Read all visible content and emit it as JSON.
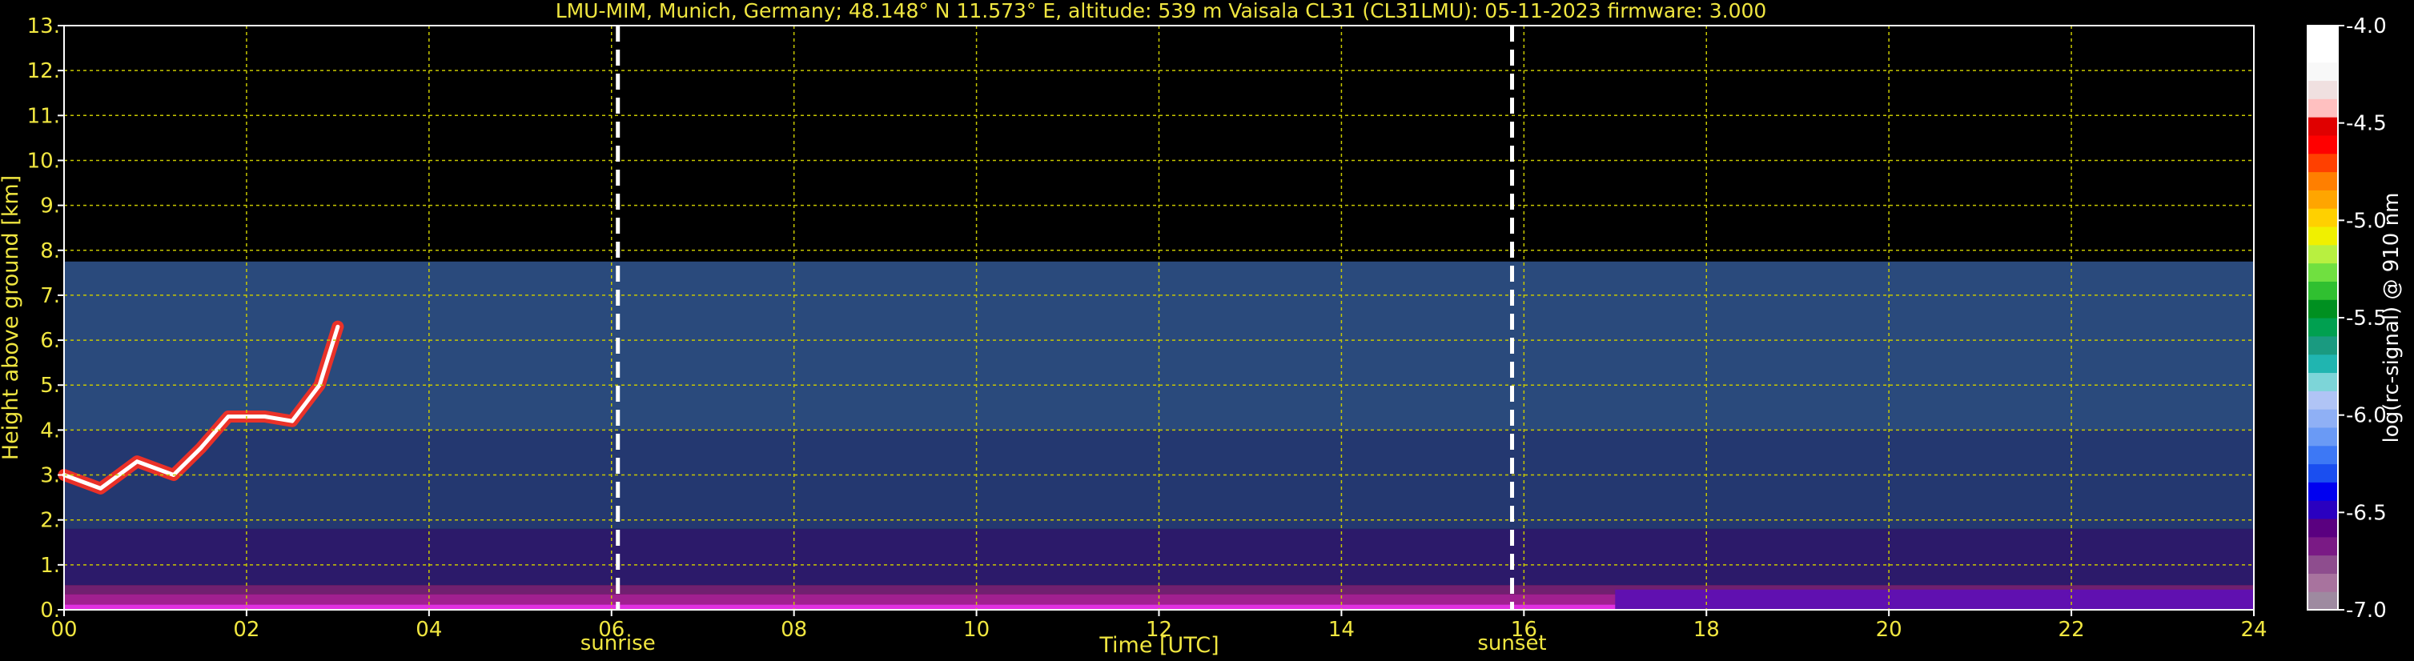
{
  "chart_data": {
    "type": "heatmap",
    "title": "LMU-MIM, Munich, Germany; 48.148° N 11.573° E, altitude: 539 m    Vaisala CL31 (CL31LMU): 05-11-2023    firmware: 3.000",
    "xlabel": "Time [UTC]",
    "ylabel": "Height above ground [km]",
    "xlim": [
      0,
      24
    ],
    "ylim": [
      0,
      13
    ],
    "x_ticks": [
      0,
      2,
      4,
      6,
      8,
      10,
      12,
      14,
      16,
      18,
      20,
      22,
      24
    ],
    "x_tick_labels": [
      "00",
      "02",
      "04",
      "06",
      "08",
      "10",
      "12",
      "14",
      "16",
      "18",
      "20",
      "22",
      "24"
    ],
    "y_ticks": [
      0,
      1,
      2,
      3,
      4,
      5,
      6,
      7,
      8,
      9,
      10,
      11,
      12,
      13
    ],
    "y_tick_labels": [
      "0.",
      "1.",
      "2.",
      "3.",
      "4.",
      "5.",
      "6.",
      "7.",
      "8.",
      "9.",
      "10.",
      "11.",
      "12.",
      "13."
    ],
    "grid": true,
    "signal_top_km": 7.75,
    "markers": [
      {
        "label": "sunrise",
        "time": 6.07
      },
      {
        "label": "sunset",
        "time": 15.87
      }
    ],
    "colorbar": {
      "label": "log(rc-signal) @ 910 nm",
      "range": [
        -7.0,
        -4.0
      ],
      "ticks": [
        -4.0,
        -4.5,
        -5.0,
        -5.5,
        -6.0,
        -6.5,
        -7.0
      ],
      "tick_labels": [
        "-4.0",
        "-4.5",
        "-5.0",
        "-5.5",
        "-6.0",
        "-6.5",
        "-7.0"
      ],
      "colors": [
        "#9e8aa0",
        "#a8739e",
        "#8e4d8e",
        "#7a1a85",
        "#5a0080",
        "#2a00c0",
        "#0000f0",
        "#1a4ef0",
        "#3d78f5",
        "#6a9af5",
        "#8fb0f5",
        "#b0c4f5",
        "#7dd5d8",
        "#20b5b0",
        "#1a9a80",
        "#00a050",
        "#009020",
        "#30c030",
        "#70e040",
        "#b8f040",
        "#f0f000",
        "#ffd000",
        "#ffa500",
        "#ff7f00",
        "#ff4000",
        "#ff0000",
        "#e00000",
        "#ffc0c0",
        "#f0e0e0",
        "#f8f8f8",
        "#ffffff",
        "#ffffff"
      ]
    },
    "layers": [
      {
        "name": "boundary-layer-bottom",
        "kind": "band",
        "t0": 0,
        "t1": 24,
        "h0": 0.0,
        "h1": 0.12,
        "color": "#e030e0"
      },
      {
        "name": "boundary-layer-mid",
        "kind": "band",
        "t0": 0,
        "t1": 24,
        "h0": 0.12,
        "h1": 0.35,
        "color": "#a02090"
      },
      {
        "name": "boundary-layer-top",
        "kind": "band",
        "t0": 0,
        "t1": 24,
        "h0": 0.35,
        "h1": 0.55,
        "color": "#702070"
      },
      {
        "name": "night-aerosol-late",
        "kind": "band",
        "t0": 17,
        "t1": 24,
        "h0": 0.0,
        "h1": 0.45,
        "color": "#6010b0"
      },
      {
        "name": "aerosol-layer",
        "kind": "band",
        "t0": 0,
        "t1": 24,
        "h0": 0.55,
        "h1": 1.8,
        "color": "#2c1a6a"
      },
      {
        "name": "noise-layer-low",
        "kind": "band",
        "t0": 0,
        "t1": 24,
        "h0": 1.8,
        "h1": 4.0,
        "color": "#243870"
      },
      {
        "name": "noise-layer-high",
        "kind": "band",
        "t0": 0,
        "t1": 24,
        "h0": 4.0,
        "h1": 7.75,
        "color": "#2a4a7c"
      }
    ],
    "cloud_traces": [
      {
        "name": "cloud-base-night",
        "points": [
          [
            0,
            3.0
          ],
          [
            0.4,
            2.7
          ],
          [
            0.8,
            3.3
          ],
          [
            1.2,
            3.0
          ],
          [
            1.5,
            3.6
          ],
          [
            1.8,
            4.3
          ],
          [
            2.2,
            4.3
          ],
          [
            2.5,
            4.2
          ],
          [
            2.8,
            5.0
          ],
          [
            3.0,
            6.3
          ]
        ],
        "color": "#ff3020",
        "core": "#ffffff",
        "width": 5
      }
    ]
  }
}
